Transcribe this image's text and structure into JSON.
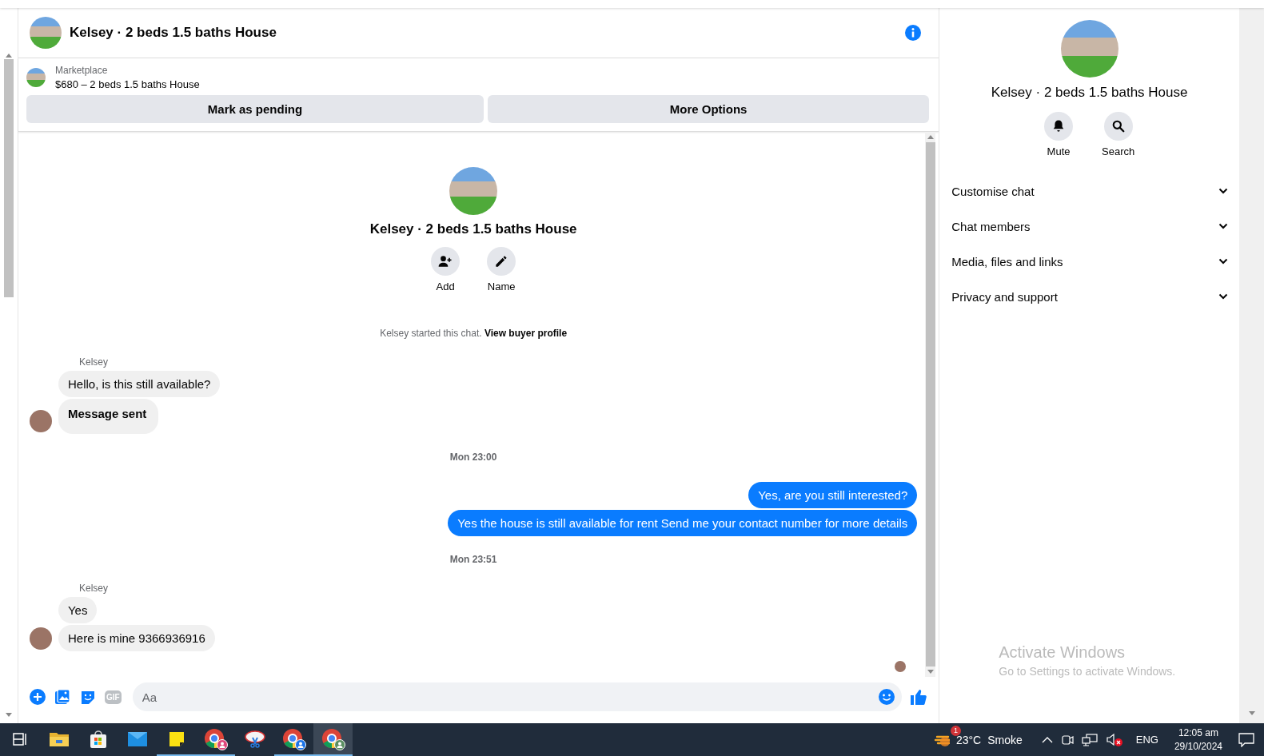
{
  "header": {
    "title": "Kelsey · 2 beds 1.5 baths House"
  },
  "listing": {
    "source": "Marketplace",
    "title": "$680 – 2 beds 1.5 baths House",
    "actions": [
      "Mark as pending",
      "More Options"
    ]
  },
  "intro": {
    "title": "Kelsey · 2 beds 1.5 baths House",
    "actions": [
      {
        "kind": "add",
        "label": "Add"
      },
      {
        "kind": "name",
        "label": "Name"
      }
    ],
    "note": "Kelsey started this chat.",
    "link": "View buyer profile"
  },
  "messages": [
    {
      "kind": "incoming",
      "sender": "Kelsey",
      "bubbles": [
        {
          "text": "Hello, is this still available?",
          "bold": false
        },
        {
          "text": "Message sent",
          "bold": true
        }
      ]
    },
    {
      "kind": "time",
      "text": "Mon 23:00"
    },
    {
      "kind": "outgoing",
      "bubbles": [
        {
          "text": "Yes, are you still interested?",
          "bold": false
        },
        {
          "text": "Yes the house is still available for rent Send me your contact number for more details",
          "bold": false
        }
      ]
    },
    {
      "kind": "time",
      "text": "Mon 23:51"
    },
    {
      "kind": "incoming",
      "sender": "Kelsey",
      "bubbles": [
        {
          "text": "Yes",
          "bold": false
        },
        {
          "text": "Here is mine 9366936916",
          "bold": false
        }
      ]
    }
  ],
  "composer": {
    "placeholder": "Aa",
    "gif": "GIF"
  },
  "panel": {
    "title": "Kelsey · 2 beds 1.5 baths House",
    "actions": [
      {
        "kind": "mute",
        "label": "Mute"
      },
      {
        "kind": "search",
        "label": "Search"
      }
    ],
    "sections": [
      {
        "label": "Customise chat",
        "expanded": false
      },
      {
        "label": "Chat members",
        "expanded": false
      },
      {
        "label": "Media, files and links",
        "expanded": false
      },
      {
        "label": "Privacy and support",
        "expanded": false
      }
    ]
  },
  "activation": {
    "title": "Activate Windows",
    "subtitle": "Go to Settings to activate Windows."
  },
  "taskbar": {
    "apps": [
      {
        "kind": "taskview",
        "running": false,
        "selected": false
      },
      {
        "kind": "explorer",
        "running": false,
        "selected": false
      },
      {
        "kind": "store",
        "running": false,
        "selected": false
      },
      {
        "kind": "mail",
        "running": false,
        "selected": false
      },
      {
        "kind": "notes",
        "running": true,
        "selected": false
      },
      {
        "kind": "chrome",
        "running": true,
        "selected": false
      },
      {
        "kind": "snip",
        "running": false,
        "selected": false
      },
      {
        "kind": "chrome-pc",
        "running": true,
        "selected": false
      },
      {
        "kind": "chrome-user",
        "running": true,
        "selected": true
      }
    ],
    "weather": {
      "badge": "1",
      "temp": "23°C",
      "condition": "Smoke"
    },
    "language": "ENG",
    "time": "12:05 am",
    "date": "29/10/2024"
  }
}
